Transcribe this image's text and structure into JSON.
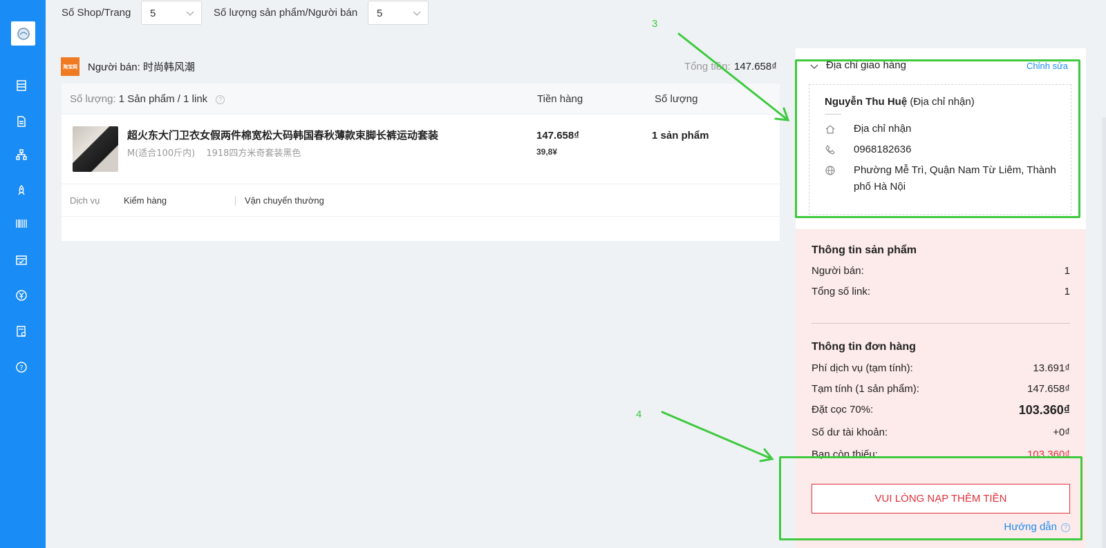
{
  "sidebar": {
    "icons": [
      "app-logo-icon",
      "list-icon",
      "document-icon",
      "hierarchy-icon",
      "rocket-icon",
      "barcode-icon",
      "calendar-check-icon",
      "yen-circle-icon",
      "receipt-icon",
      "help-circle-icon"
    ],
    "accent": "#1a8cf5"
  },
  "filters": {
    "shop_per_page_label": "Số Shop/Trang",
    "shop_per_page_value": "5",
    "products_per_seller_label": "Số lượng sản phẩm/Người bán",
    "products_per_seller_value": "5"
  },
  "seller": {
    "logo_text": "淘宝网",
    "name": "Người bán: 时尚韩风潮",
    "total_label": "Tổng tiền:",
    "total_value": "147.658₫"
  },
  "table": {
    "quantity_label": "Số lượng:",
    "quantity_value": "1 Sản phẩm / 1 link",
    "col_price": "Tiền hàng",
    "col_qty": "Số lượng",
    "product": {
      "title": "超火东大门卫衣女假两件棉宽松大码韩国春秋薄款束脚长裤运动套装",
      "variant_size": "M(适合100斤内)",
      "variant_color": "1918四方米奇套装黑色",
      "price_vnd": "147.658₫",
      "price_cny": "39,8¥",
      "qty": "1 sản phẩm"
    },
    "service": {
      "label": "Dịch vụ",
      "items": [
        "Kiểm hàng",
        "Vận chuyển thường"
      ]
    }
  },
  "address": {
    "title": "Địa chỉ giao hàng",
    "edit": "Chỉnh sửa",
    "recipient_name": "Nguyễn Thu Huệ",
    "recipient_note": "(Địa chỉ nhận)",
    "type": "Địa chỉ nhận",
    "phone": "0968182636",
    "location": "Phường Mễ Trì, Quận Nam Từ Liêm, Thành phố Hà Nội"
  },
  "summary": {
    "product_info_title": "Thông tin sản phẩm",
    "seller_label": "Người bán:",
    "seller_value": "1",
    "links_label": "Tổng số link:",
    "links_value": "1",
    "order_info_title": "Thông tin đơn hàng",
    "service_fee_label": "Phí dịch vụ (tạm tính):",
    "service_fee_value": "13.691₫",
    "subtotal_label": "Tạm tính (1 sản phẩm):",
    "subtotal_value": "147.658₫",
    "deposit_label": "Đặt cọc 70%:",
    "deposit_value": "103.360₫",
    "balance_label": "Số dư tài khoản:",
    "balance_value": "+0₫",
    "missing_label": "Bạn còn thiếu:",
    "missing_value": "103.360₫",
    "topup_button": "VUI LÒNG NẠP THÊM TIỀN",
    "guide": "Hướng dẫn"
  },
  "annotations": {
    "label_3": "3",
    "label_4": "4",
    "color": "#3ec93e"
  },
  "colors": {
    "danger": "#e0313a",
    "summary_bg": "#fdeaea",
    "page_bg": "#eef2f5"
  }
}
